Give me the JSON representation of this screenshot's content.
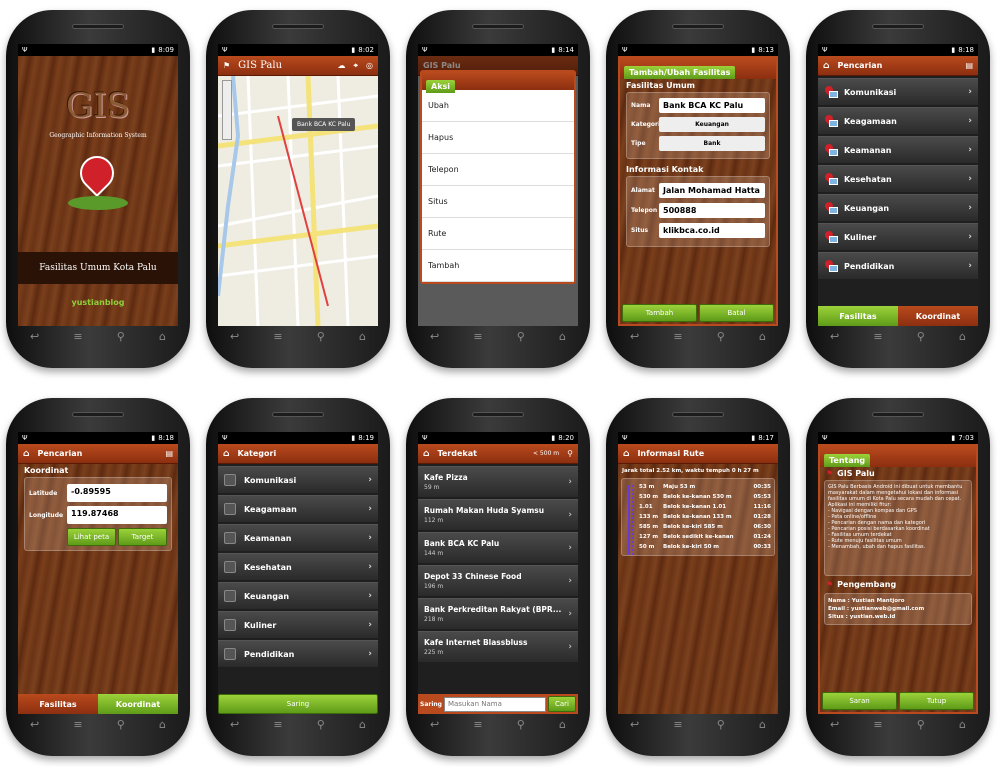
{
  "status": {
    "t1": "8:09",
    "t2": "8:02",
    "t3": "8:14",
    "t4": "8:13",
    "t5": "8:18",
    "t6": "8:18",
    "t7": "8:19",
    "t8": "8:20",
    "t9": "8:17",
    "t10": "7:03"
  },
  "splash": {
    "logo": "GIS",
    "subtitle": "Geographic Information System",
    "bottom": "Fasilitas Umum Kota Palu",
    "brand": "yustianblog"
  },
  "map": {
    "title": "GIS Palu",
    "callout": "Bank BCA KC Palu"
  },
  "aksi": {
    "title": "Aksi",
    "items": [
      "Ubah",
      "Hapus",
      "Telepon",
      "Situs",
      "Rute",
      "Tambah"
    ],
    "bg_title": "GIS Palu"
  },
  "form": {
    "tab": "Tambah/Ubah Fasilitas",
    "sec1": "Fasilitas Umum",
    "nama_l": "Nama",
    "nama_v": "Bank BCA KC Palu",
    "kat_l": "Kategori",
    "kat_v": "Keuangan",
    "tipe_l": "Tipe",
    "tipe_v": "Bank",
    "sec2": "Informasi Kontak",
    "alamat_l": "Alamat",
    "alamat_v": "Jalan Mohamad Hatta",
    "tel_l": "Telepon",
    "tel_v": "500888",
    "situs_l": "Situs",
    "situs_v": "klikbca.co.id",
    "btn1": "Tambah",
    "btn2": "Batal"
  },
  "pencarian": {
    "title": "Pencarian",
    "items": [
      "Komunikasi",
      "Keagamaan",
      "Keamanan",
      "Kesehatan",
      "Keuangan",
      "Kuliner",
      "Pendidikan"
    ],
    "tab1": "Fasilitas",
    "tab2": "Koordinat"
  },
  "koordinat": {
    "title": "Pencarian",
    "sec": "Koordinat",
    "lat_l": "Latitude",
    "lat_v": "-0.89595",
    "lon_l": "Longitude",
    "lon_v": "119.87468",
    "btn1": "Lihat peta",
    "btn2": "Target",
    "tab1": "Fasilitas",
    "tab2": "Koordinat"
  },
  "kategori": {
    "title": "Kategori",
    "items": [
      "Komunikasi",
      "Keagamaan",
      "Keamanan",
      "Kesehatan",
      "Keuangan",
      "Kuliner",
      "Pendidikan"
    ],
    "btn": "Saring"
  },
  "terdekat": {
    "title": "Terdekat",
    "radius": "< 500 m",
    "items": [
      {
        "n": "Kafe Pizza",
        "d": "59 m"
      },
      {
        "n": "Rumah Makan Huda Syamsu",
        "d": "112 m"
      },
      {
        "n": "Bank BCA KC Palu",
        "d": "144 m"
      },
      {
        "n": "Depot 33 Chinese Food",
        "d": "196 m"
      },
      {
        "n": "Bank Perkreditan Rakyat (BPR...",
        "d": "218 m"
      },
      {
        "n": "Kafe Internet Blassbluss",
        "d": "225 m"
      }
    ],
    "saring": "Saring",
    "placeholder": "Masukan Nama",
    "cari": "Cari"
  },
  "rute": {
    "title": "Informasi Rute",
    "summary": "Jarak total 2.52 km, waktu tempuh 0 h 27 m",
    "steps": [
      {
        "d": "53 m",
        "a": "Maju 53 m",
        "t": "00:35"
      },
      {
        "d": "530 m",
        "a": "Belok ke-kanan 530 m",
        "t": "05:53"
      },
      {
        "d": "1.01",
        "a": "Belok ke-kanan 1.01",
        "t": "11:16"
      },
      {
        "d": "133 m",
        "a": "Belok ke-kanan 133 m",
        "t": "01:28"
      },
      {
        "d": "585 m",
        "a": "Belok ke-kiri 585 m",
        "t": "06:30"
      },
      {
        "d": "127 m",
        "a": "Belok sedikit ke-kanan",
        "t": "01:24"
      },
      {
        "d": "50 m",
        "a": "Belok ke-kiri 50 m",
        "t": "00:33"
      }
    ]
  },
  "tentang": {
    "tab": "Tentang",
    "app": "GIS Palu",
    "desc": "GIS Palu Berbasis Android ini dibuat untuk membantu masyarakat dalam mengetahui lokasi dan informasi fasilitas umum di Kota Palu secara mudah dan cepat. Aplikasi ini memiliki fitur:",
    "features": [
      "- Navigasi dengan kompas dan GPS",
      "- Peta online/offline",
      "- Pencarian dengan nama dan kategori",
      "- Pencarian posisi berdasarkan koordinat",
      "- Fasilitas umum terdekat",
      "- Rute menuju fasilitas umum",
      "- Menambah, ubah dan hapus fasilitas."
    ],
    "dev": "Pengembang",
    "nama": "Nama : Yustian Mantjoro",
    "email": "Email : yustianweb@gmail.com",
    "situs": "Situs : yustian.web.id",
    "btn1": "Saran",
    "btn2": "Tutup"
  }
}
